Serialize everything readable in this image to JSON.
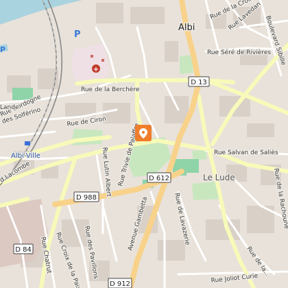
{
  "map": {
    "city": "Albi",
    "city_rail_station": "Albi-Ville",
    "district": "Le Lude",
    "hospital_symbol": "+",
    "parking_symbol": "P",
    "marker_color": "#f07d2b",
    "colors": {
      "land": "#e8e2da",
      "block": "#d9d0c8",
      "park": "#c8e7bf",
      "sport": "#8fd3a8",
      "water": "#a9d3df",
      "primary_road": "#f8d28a",
      "secondary_road": "#f7fab9",
      "minor_road": "#ffffff",
      "rail": "#888888",
      "hospital_area": "#efe0e5"
    },
    "road_shields": {
      "d13": "D 13",
      "d612": "D 612",
      "d988": "D 988",
      "d84": "D 84",
      "d912": "D 912"
    },
    "streets": {
      "rue_croix": "Rue de la Croix",
      "rue_lavedan": "Rue Lavedan",
      "boulevard_sibille": "Boulevard Sibille",
      "rue_sere_rivieres": "Rue Séré de Rivières",
      "rue_berchere": "Rue de la Berchère",
      "rue_ciron": "Rue de Ciron",
      "rue_solferino": "des Solférino",
      "rue_dordogne": "Rue Dordogne",
      "lande": "Lande",
      "lacombe": "d Lacombe",
      "rue_salvan_sallies": "Rue Salvan de Saliès",
      "rue_lutin_albert": "Rue Lutin Albert",
      "rue_palaffre": "Rue Trivie de Palaffre",
      "rue_lavazerie": "Rue de Lavazerie",
      "rue_rachoune": "Rue de la Rachoune",
      "avenue_gambetta": "Avenue Gambetta",
      "rue_pavillons": "Rue des Pavillons",
      "rue_chatrut": "Rue Chatrut",
      "rue_croix_paix": "Rue Croix de la Paix",
      "rue_joliot_curie": "Rue Joliot Curie",
      "rue_la_tronq": "Rue de la..."
    }
  }
}
